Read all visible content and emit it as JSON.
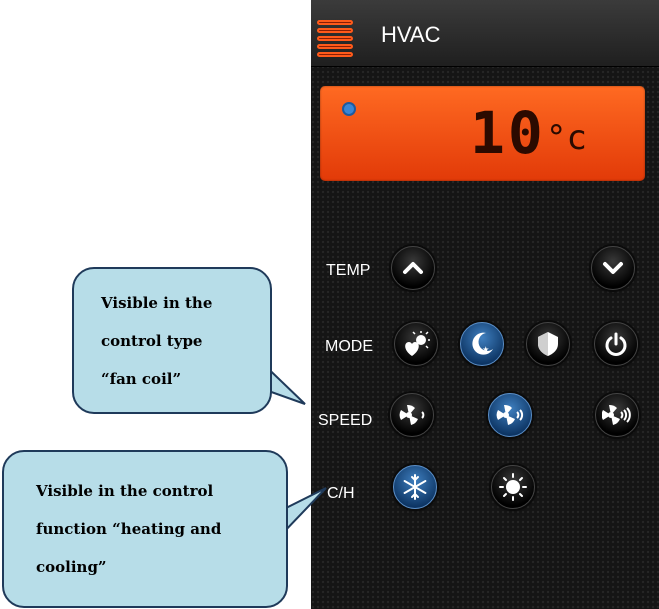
{
  "header": {
    "title": "HVAC",
    "menu_icon": "menu-icon"
  },
  "display": {
    "temperature": "10",
    "unit": "°c",
    "fan_status_icon": "fan-dot-icon"
  },
  "rows": {
    "temp": {
      "label": "TEMP",
      "up_icon": "chevron-up-icon",
      "down_icon": "chevron-down-icon"
    },
    "mode": {
      "label": "MODE",
      "buttons": [
        "heart-sun-icon",
        "moon-stars-icon",
        "shield-icon",
        "power-icon"
      ],
      "active_index": 1
    },
    "speed": {
      "label": "SPEED",
      "buttons": [
        "fan-low-icon",
        "fan-medium-icon",
        "fan-high-icon"
      ],
      "active_index": 1
    },
    "ch": {
      "label": "C/H",
      "buttons": [
        "snowflake-icon",
        "sun-icon"
      ],
      "active_index": 0
    }
  },
  "callouts": {
    "top": {
      "lines": [
        "Visible in the",
        "control type",
        "“fan coil”"
      ]
    },
    "bottom": {
      "lines": [
        "Visible in the control",
        "function “heating and",
        "cooling”"
      ]
    }
  },
  "colors": {
    "display": "#ff5a1a",
    "active_button": "#1d5aa0",
    "callout_fill": "#b7dde8",
    "callout_border": "#1f3a5a"
  }
}
